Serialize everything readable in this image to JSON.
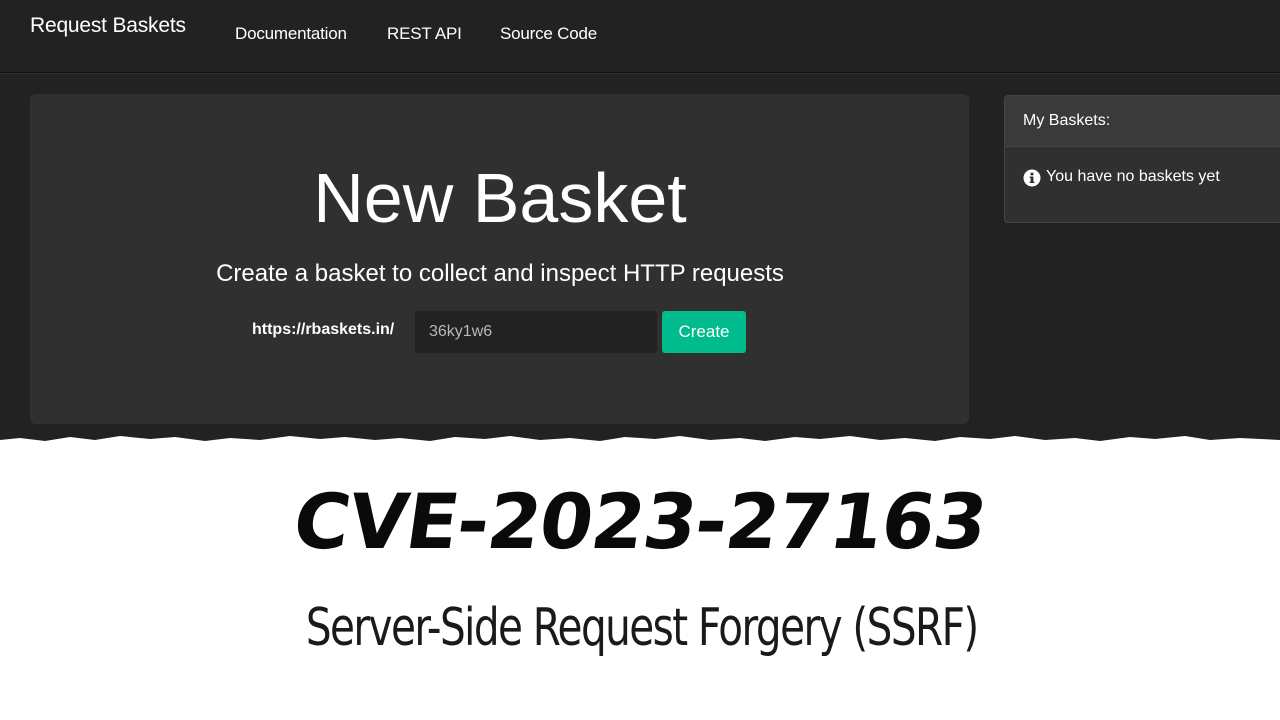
{
  "navbar": {
    "brand": "Request Baskets",
    "links": [
      "Documentation",
      "REST API",
      "Source Code"
    ]
  },
  "jumbotron": {
    "title": "New Basket",
    "subtitle": "Create a basket to collect and inspect HTTP requests",
    "url_prefix": "https://rbaskets.in/",
    "basket_name_value": "36ky1w6",
    "create_label": "Create"
  },
  "my_baskets": {
    "title": "My Baskets:",
    "empty_message": "You have no baskets yet"
  },
  "banner": {
    "title": "CVE-2023-27163",
    "subtitle": "Server-Side Request Forgery (SSRF)"
  },
  "icons": {
    "info": "info-circle-icon"
  },
  "colors": {
    "background": "#222222",
    "jumbotron": "#303030",
    "accent": "#00bc8c",
    "banner_background": "#ffffff"
  }
}
